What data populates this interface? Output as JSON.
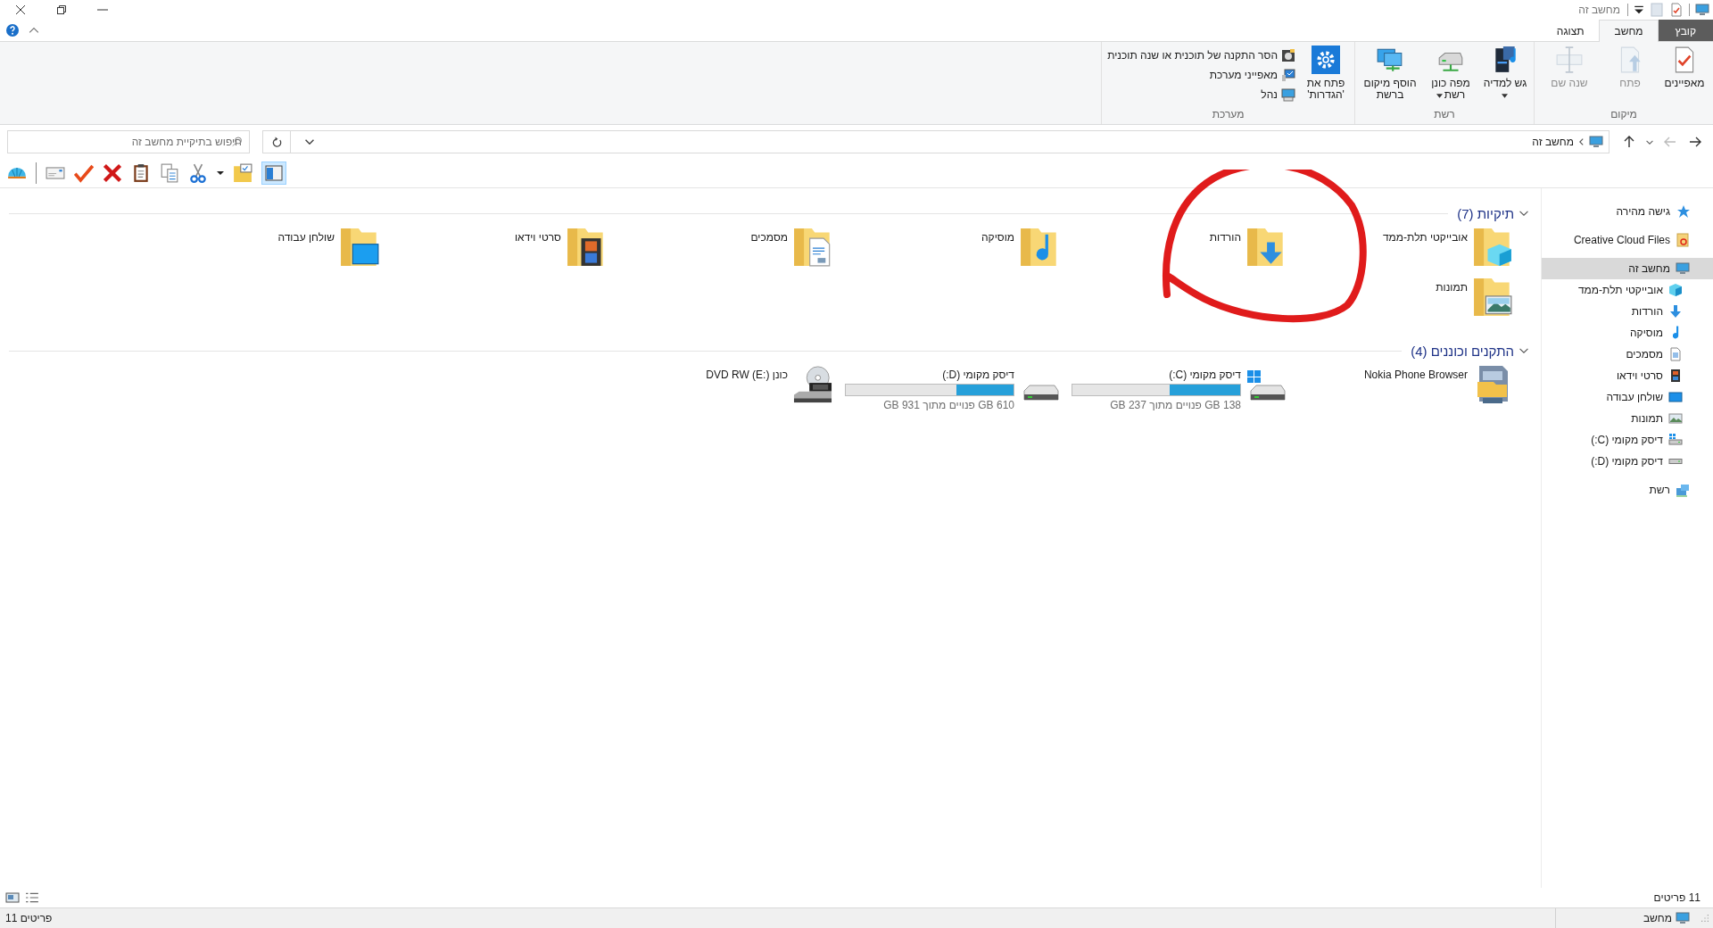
{
  "window": {
    "title": "מחשב זה"
  },
  "ribbon": {
    "tabs": [
      {
        "label": "קובץ",
        "kind": "file",
        "selected": false
      },
      {
        "label": "מחשב",
        "kind": "tab",
        "selected": true
      },
      {
        "label": "תצוגה",
        "kind": "tab",
        "selected": false
      }
    ],
    "groups": [
      {
        "label": "מיקום",
        "commands": [
          {
            "label": "מאפיינים",
            "disabled": false,
            "dropdown": false
          },
          {
            "label": "פתח",
            "disabled": true,
            "dropdown": false
          },
          {
            "label": "שנה שם",
            "disabled": true,
            "dropdown": false
          }
        ]
      },
      {
        "label": "רשת",
        "commands": [
          {
            "label": "גש למדיה",
            "disabled": false,
            "dropdown": true
          },
          {
            "label": "מפה כונן רשת",
            "disabled": false,
            "dropdown": true
          },
          {
            "label": "הוסף מיקום ברשת",
            "disabled": false,
            "dropdown": false
          }
        ]
      },
      {
        "label": "מערכת",
        "commands": [
          {
            "label": "פתח את 'הגדרות'",
            "disabled": false,
            "dropdown": false
          }
        ],
        "small_commands": [
          {
            "label": "הסר התקנה של תוכנית או שנה תוכנית"
          },
          {
            "label": "מאפייני מערכת"
          },
          {
            "label": "נהל"
          }
        ]
      }
    ]
  },
  "navigation": {
    "back": {
      "disabled": false
    },
    "forward": {
      "disabled": true
    }
  },
  "address": {
    "path": "מחשב זה"
  },
  "search": {
    "placeholder": "חיפוש בתיקיית מחשב זה"
  },
  "toolbar": {
    "pane_toggle_on": true
  },
  "sidebar": {
    "items": [
      {
        "label": "גישה מהירה",
        "selected": false
      },
      {
        "label": "Creative Cloud Files",
        "selected": false
      },
      {
        "label": "מחשב זה",
        "selected": true,
        "children": [
          {
            "label": "אובייקטי תלת-ממד",
            "selected": false
          },
          {
            "label": "הורדות",
            "selected": false
          },
          {
            "label": "מוסיקה",
            "selected": false
          },
          {
            "label": "מסמכים",
            "selected": false
          },
          {
            "label": "סרטי וידאו",
            "selected": false
          },
          {
            "label": "שולחן עבודה",
            "selected": false
          },
          {
            "label": "תמונות",
            "selected": false
          },
          {
            "label": "דיסק מקומי (C:)",
            "selected": false
          },
          {
            "label": "דיסק מקומי (D:)",
            "selected": false
          }
        ]
      },
      {
        "label": "רשת",
        "selected": false
      }
    ]
  },
  "sections": [
    {
      "title": "תיקיות (7)",
      "expanded": true,
      "items": [
        {
          "kind": "folder",
          "label": "אובייקטי תלת-ממד"
        },
        {
          "kind": "folder",
          "label": "הורדות"
        },
        {
          "kind": "folder",
          "label": "מוסיקה"
        },
        {
          "kind": "folder",
          "label": "מסמכים"
        },
        {
          "kind": "folder",
          "label": "סרטי וידאו"
        },
        {
          "kind": "folder",
          "label": "שולחן עבודה"
        },
        {
          "kind": "folder",
          "label": "תמונות"
        }
      ]
    },
    {
      "title": "התקנים וכוננים (4)",
      "expanded": true,
      "items": [
        {
          "kind": "device",
          "label": "Nokia Phone Browser"
        },
        {
          "kind": "drive",
          "label": "דיסק מקומי (C:)",
          "level": 0.42,
          "space": "138 GB פנויים מתוך 237 GB",
          "system": true
        },
        {
          "kind": "drive",
          "label": "דיסק מקומי (D:)",
          "level": 0.34,
          "space": "610 GB פנויים מתוך 931 GB",
          "system": false
        },
        {
          "kind": "optical",
          "label": "כונן DVD RW (E:)"
        }
      ]
    }
  ],
  "status": {
    "item_count": "11 פריטים"
  },
  "bottom_bar": {
    "left": "11 פריטים",
    "right": "מחשב"
  }
}
